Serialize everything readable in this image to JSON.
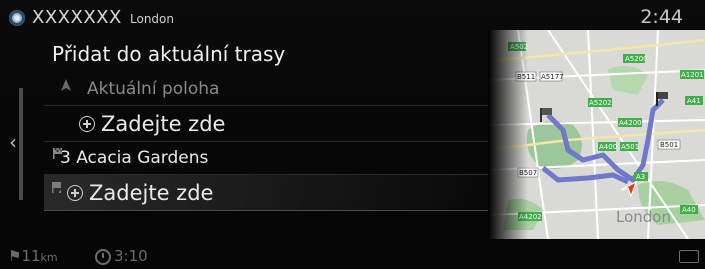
{
  "status": {
    "name": "XXXXXXX",
    "location": "London",
    "clock": "2:44"
  },
  "page_title": "Přidat do aktuální trasy",
  "route": [
    {
      "label": "Aktuální poloha",
      "kind": "origin",
      "dim": true
    },
    {
      "label": "Zadejte zde",
      "kind": "add",
      "dim": false
    },
    {
      "label": "3 Acacia Gardens",
      "kind": "waypoint",
      "dim": false
    },
    {
      "label": "Zadejte zde",
      "kind": "add-destination",
      "dim": false
    }
  ],
  "bottom": {
    "distance": "11",
    "distance_unit": "km",
    "time": "3:10"
  },
  "map": {
    "city_label": "London",
    "road_labels": [
      "A502",
      "A5200",
      "A1201",
      "A41",
      "A5202",
      "A4200",
      "A501",
      "B501",
      "B507",
      "A400",
      "B511",
      "A4202",
      "A3",
      "A40"
    ]
  }
}
